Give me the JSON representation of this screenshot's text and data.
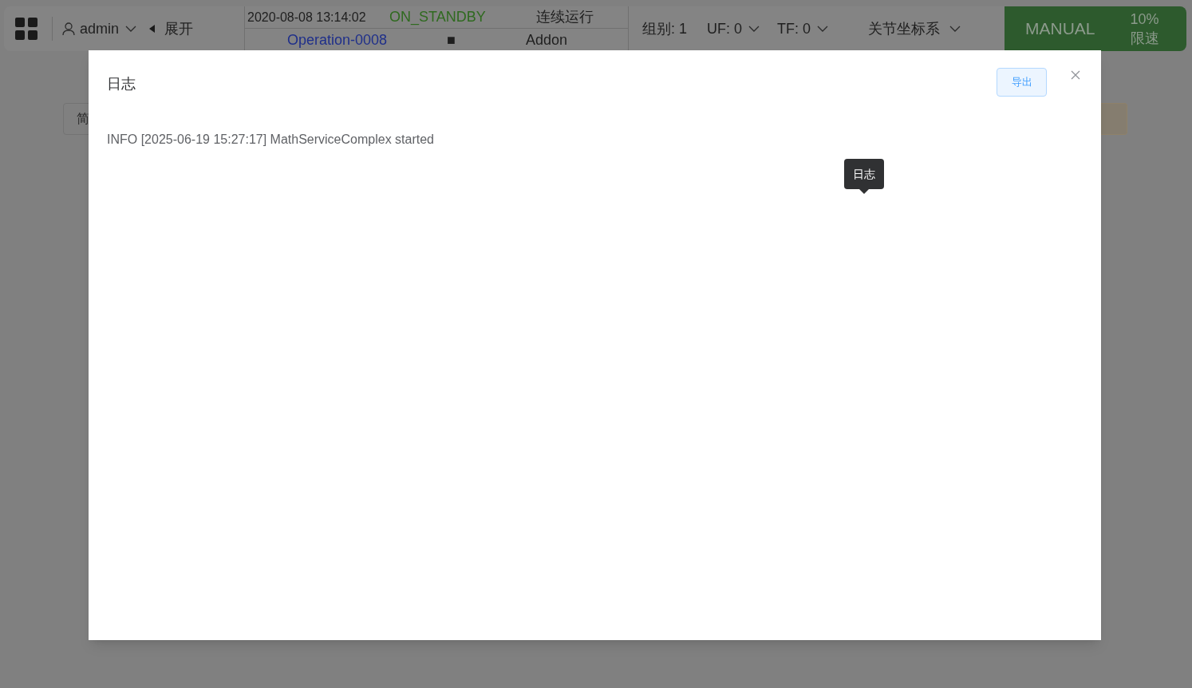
{
  "topbar": {
    "user": "admin",
    "expand": "展开",
    "datetime": "2020-08-08 13:14:02",
    "state": "ON_STANDBY",
    "run_mode": "连续运行",
    "program": "Operation-0008",
    "stop_symbol": "■",
    "addon": "Addon",
    "group": "组别: 1",
    "uf": "UF: 0",
    "tf": "TF: 0",
    "coord": "关节坐标系",
    "mode": "MANUAL",
    "speed": "10%",
    "speed_label": "限速"
  },
  "background": {
    "left_button": "简"
  },
  "dialog": {
    "title": "日志",
    "export_button": "导出",
    "lines": [
      "INFO [2025-06-19 15:27:17] MathServiceComplex started"
    ]
  },
  "tooltip": {
    "text": "日志"
  }
}
